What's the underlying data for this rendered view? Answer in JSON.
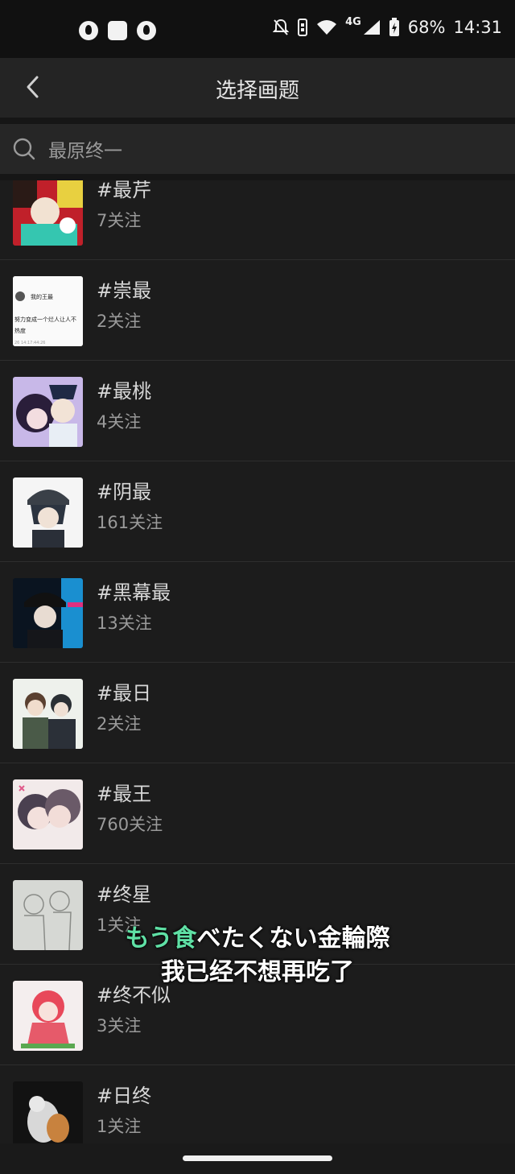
{
  "status_bar": {
    "network": "4G",
    "battery": "68%",
    "time": "14:31"
  },
  "header": {
    "title": "选择画题",
    "back_icon": "chevron-left-icon"
  },
  "search": {
    "value": "最原终一",
    "placeholder": ""
  },
  "topics": [
    {
      "name": "#最芹",
      "followers": "7关注"
    },
    {
      "name": "#崇最",
      "followers": "2关注"
    },
    {
      "name": "#最桃",
      "followers": "4关注"
    },
    {
      "name": "#阴最",
      "followers": "161关注"
    },
    {
      "name": "#黑幕最",
      "followers": "13关注"
    },
    {
      "name": "#最日",
      "followers": "2关注"
    },
    {
      "name": "#最王",
      "followers": "760关注"
    },
    {
      "name": "#终星",
      "followers": "1关注"
    },
    {
      "name": "#终不似",
      "followers": "3关注"
    },
    {
      "name": "#日终",
      "followers": "1关注"
    }
  ],
  "thumbnail_text": {
    "user": "我的王最",
    "line1": "努力变成一个烂人让人不",
    "line2": "热度",
    "time": "26 14:17:44:26"
  },
  "subtitles": {
    "line1_highlight": "もう食",
    "line1_rest": "べたくない金輪際",
    "line2": "我已经不想再吃了"
  },
  "colors": {
    "background": "#1c1c1c",
    "header": "#242424",
    "subtitle_highlight": "#5fe0a5"
  }
}
